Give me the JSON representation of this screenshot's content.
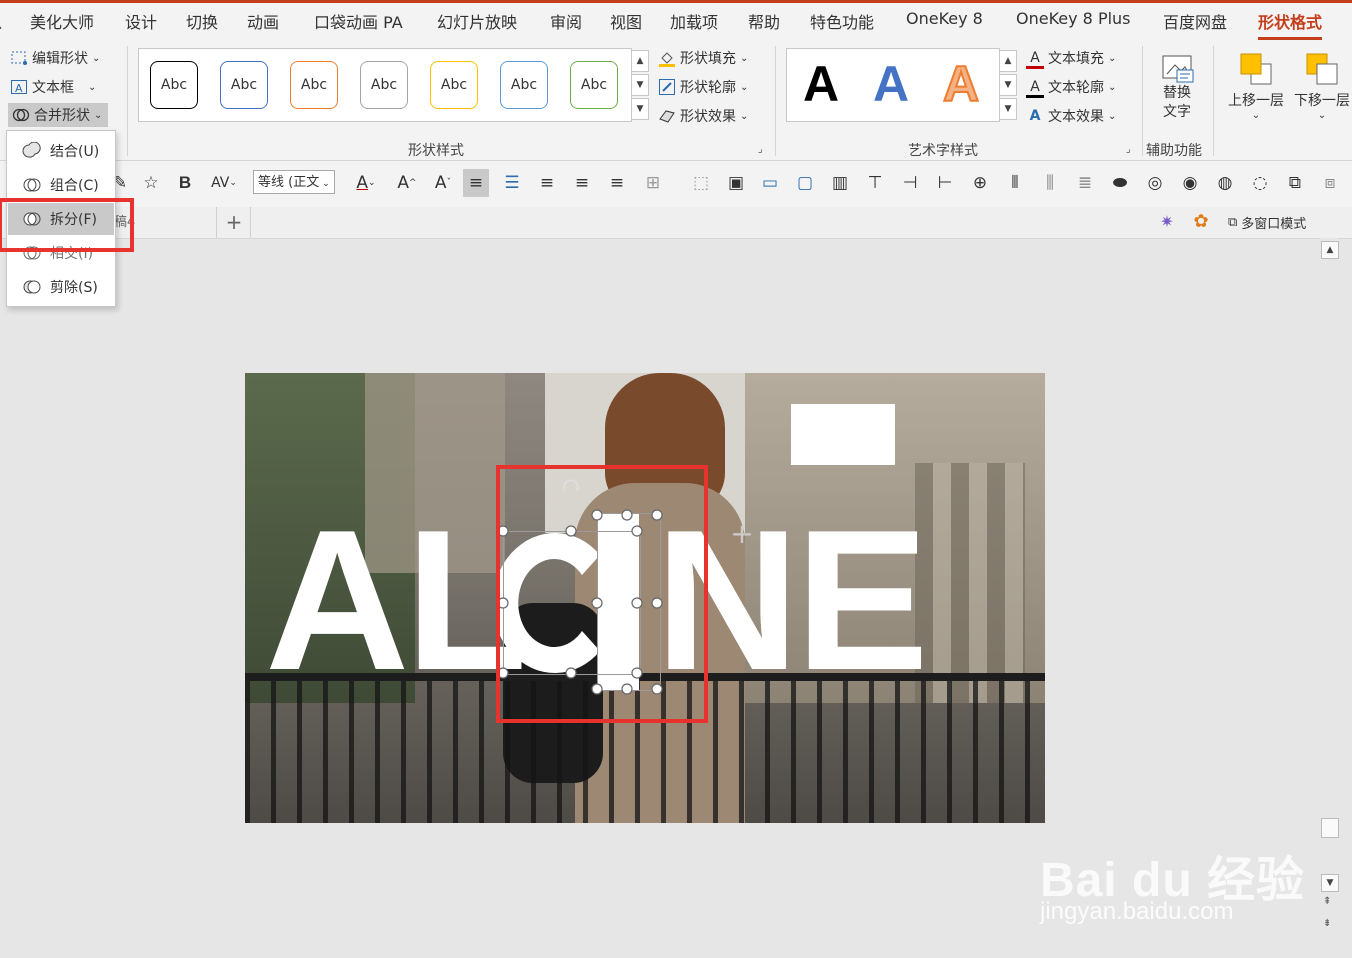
{
  "ribbon_tabs": [
    "美化大师",
    "设计",
    "切换",
    "动画",
    "口袋动画 PA",
    "幻灯片放映",
    "审阅",
    "视图",
    "加载项",
    "帮助",
    "特色功能",
    "OneKey 8",
    "OneKey 8 Plus",
    "百度网盘",
    "形状格式"
  ],
  "active_tab": "形状格式",
  "insert_group": {
    "edit_shape": "编辑形状",
    "textbox": "文本框",
    "merge_shapes": "合并形状"
  },
  "shape_styles": {
    "sample_text": "Abc",
    "fill": "形状填充",
    "outline": "形状轮廓",
    "effects": "形状效果",
    "group_label": "形状样式",
    "border_colors": [
      "#000000",
      "#4472c4",
      "#ed7d31",
      "#a5a5a5",
      "#ffc000",
      "#5b9bd5",
      "#70ad47"
    ]
  },
  "wordart": {
    "letter": "A",
    "text_fill": "文本填充",
    "text_outline": "文本轮廓",
    "text_effects": "文本效果",
    "group_label": "艺术字样式"
  },
  "accessibility": {
    "alt_text_line1": "替换",
    "alt_text_line2": "文字",
    "group_label": "辅助功能"
  },
  "arrange": {
    "bring_forward": "上移一层",
    "send_backward": "下移一层"
  },
  "merge_menu": {
    "items": [
      "结合(U)",
      "组合(C)",
      "拆分(F)",
      "相交(I)",
      "剪除(S)"
    ],
    "highlighted": "拆分(F)"
  },
  "toolbar": {
    "bold": "B",
    "font_name": "等线 (正文"
  },
  "slide_tabs": {
    "title": "稿4",
    "add": "+",
    "multi_window": "多窗口模式"
  },
  "slide": {
    "text_left": "AL",
    "text_right": "NE"
  },
  "watermark": {
    "brand": "Bai du 经验",
    "url": "jingyan.baidu.com"
  },
  "colors": {
    "accent": "#c43e1c",
    "highlight_box": "#e8322e"
  }
}
